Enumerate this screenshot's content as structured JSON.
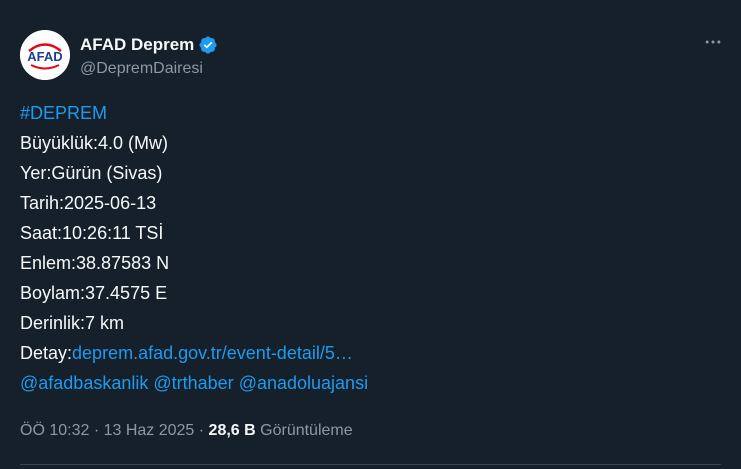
{
  "author": {
    "display_name": "AFAD Deprem",
    "handle": "@DepremDairesi",
    "avatar_text": "AFAD",
    "verified": true
  },
  "tweet": {
    "hashtag": "#DEPREM",
    "magnitude": "Büyüklük:4.0 (Mw)",
    "location": "Yer:Gürün (Sivas)",
    "date": "Tarih:2025-06-13",
    "time": "Saat:10:26:11 TSİ",
    "latitude": "Enlem:38.87583 N",
    "longitude": "Boylam:37.4575 E",
    "depth": "Derinlik:7 km",
    "detail_label": "Detay:",
    "detail_link": "deprem.afad.gov.tr/event-detail/5…",
    "mentions": [
      "@afadbaskanlik",
      "@trthaber",
      "@anadoluajansi"
    ]
  },
  "meta": {
    "time": "ÖÖ 10:32",
    "separator": " · ",
    "date": "13 Haz 2025",
    "views_count": "28,6 B",
    "views_label": "Görüntüleme"
  },
  "colors": {
    "background": "#15202b",
    "link": "#1d9bf0",
    "secondary_text": "#8b98a5",
    "primary_text": "#f7f9f9",
    "brand_red": "#e30613",
    "brand_blue": "#1c3f94"
  },
  "icons": {
    "verified": "verified-badge-icon",
    "more": "more-options-icon"
  }
}
